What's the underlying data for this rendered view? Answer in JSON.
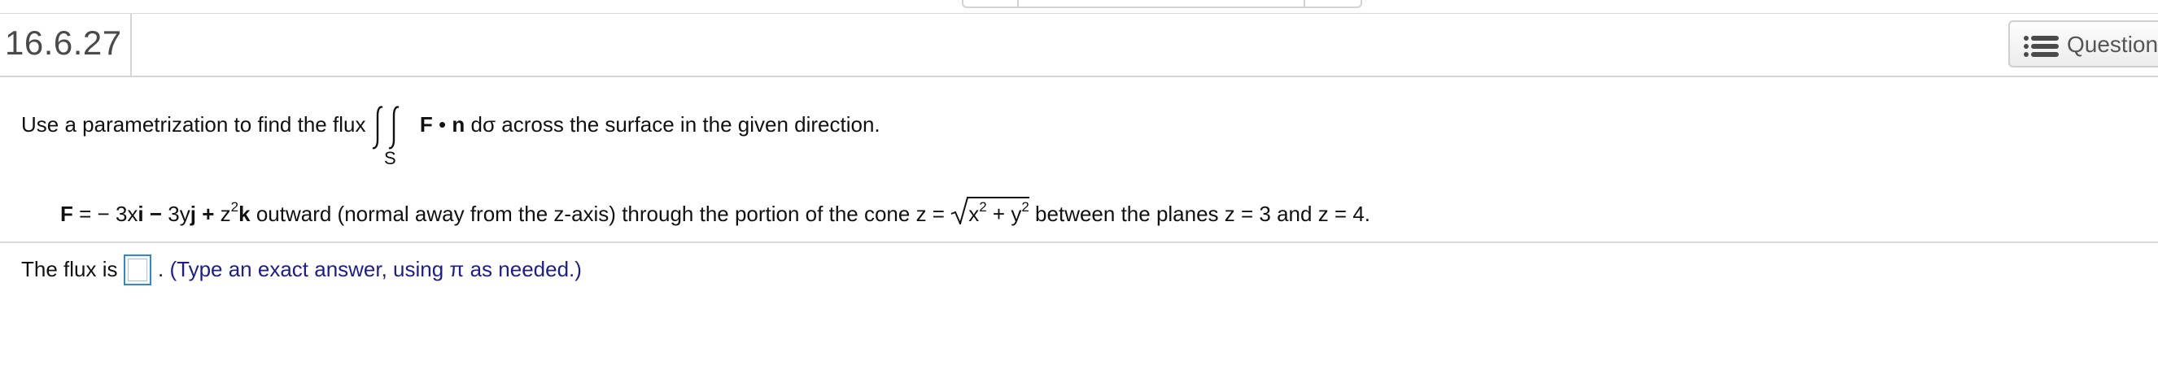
{
  "header": {
    "question_number": "16.6.27",
    "question_menu_label": "Question"
  },
  "problem": {
    "stem_before": "Use a parametrization to find the flux",
    "stem_integrand_F": "F",
    "stem_integrand_dot": "•",
    "stem_integrand_n": "n",
    "stem_integrand_dsigma": "dσ",
    "stem_after": "across the surface in the given direction.",
    "surface_subscript": "S",
    "field": {
      "F_label": "F",
      "eq_part1": "= − 3x",
      "i": "i",
      "minus": "−",
      "eq_part2": "3y",
      "j": "j",
      "plus": "+",
      "eq_part3": "z",
      "exp2": "2",
      "k": "k",
      "description": "outward (normal away from the z-axis) through the portion of the cone z =",
      "sqrt_x": "x",
      "sqrt_plus": "+",
      "sqrt_y": "y",
      "tail": "between the planes z = 3 and z = 4."
    }
  },
  "answer": {
    "label": "The flux is",
    "input_value": "",
    "hint_dot": ".",
    "hint": "(Type an exact answer, using π as needed.)"
  }
}
